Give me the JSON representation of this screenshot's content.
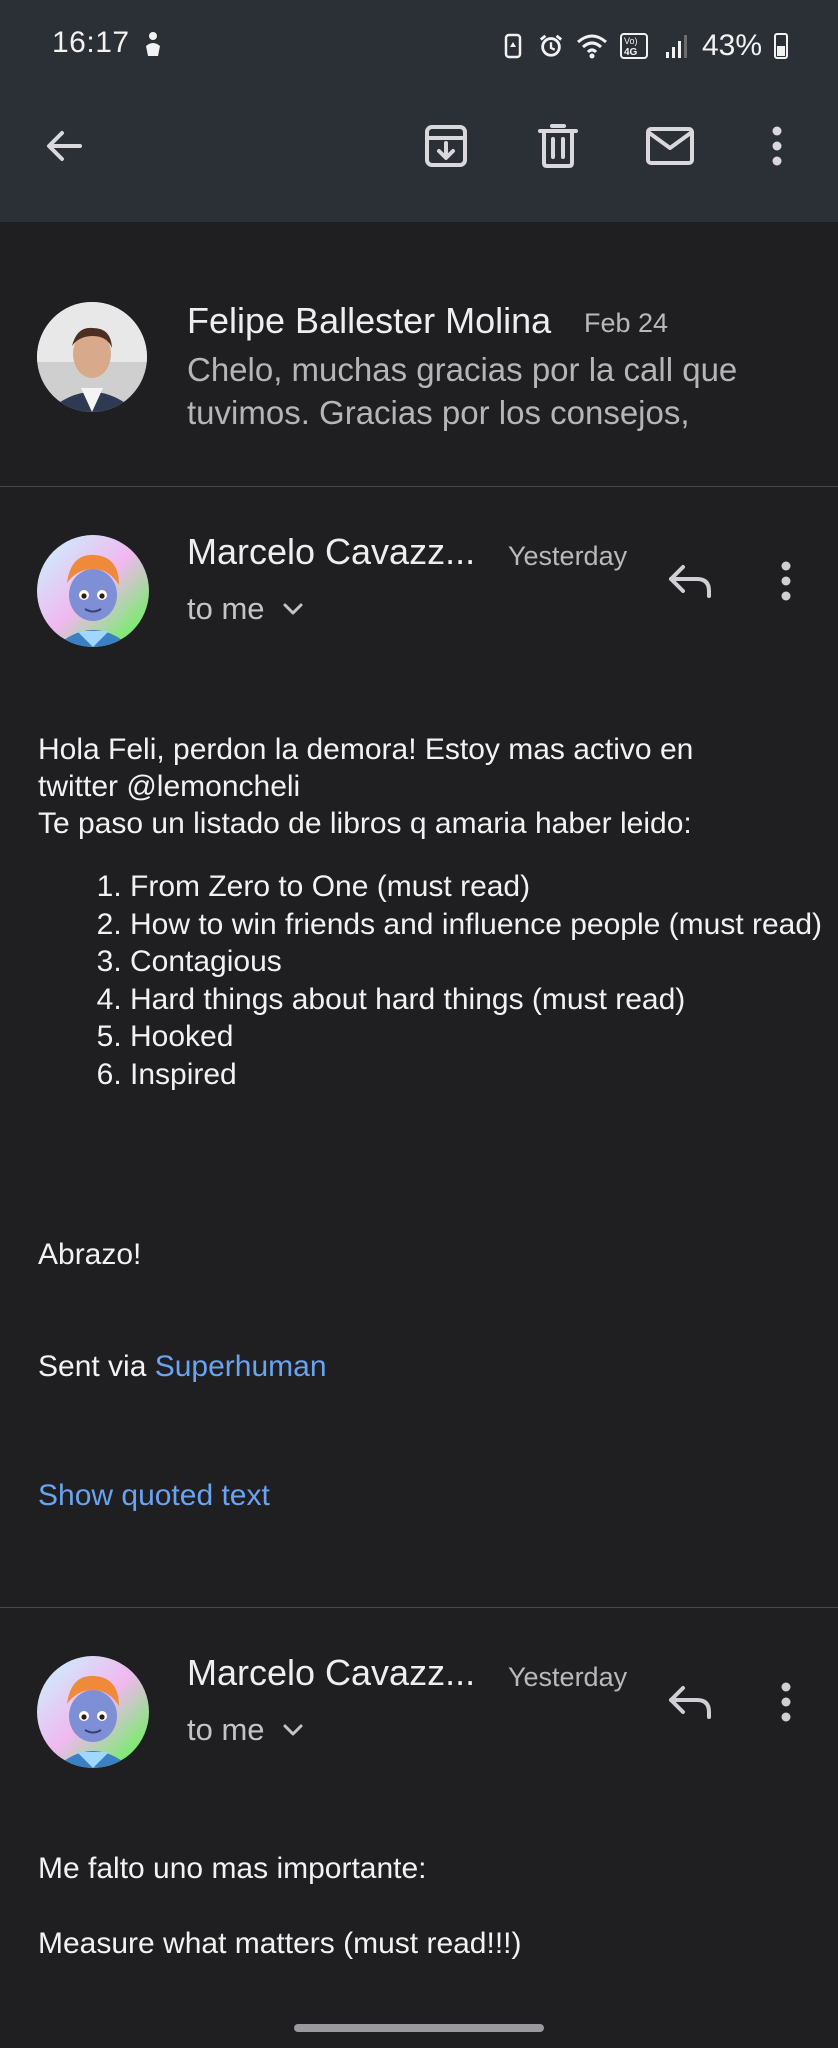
{
  "status_bar": {
    "time": "16:17",
    "battery_percent": "43%",
    "icons": [
      "accessibility-icon",
      "battery-saver-icon",
      "alarm-icon",
      "wifi-icon",
      "volte-4g-icon",
      "signal-icon",
      "battery-icon"
    ]
  },
  "toolbar": {
    "back_icon": "arrow-left-icon",
    "archive_icon": "archive-icon",
    "delete_icon": "trash-icon",
    "mark_unread_icon": "mail-icon",
    "more_icon": "more-vert-icon"
  },
  "collapsed_message": {
    "sender": "Felipe Ballester Molina",
    "date": "Feb 24",
    "snippet": "Chelo, muchas gracias por la call que tuvimos. Gracias por los consejos,"
  },
  "message1": {
    "sender": "Marcelo Cavazz...",
    "date": "Yesterday",
    "recipient": "to me",
    "greeting_line1": "Hola Feli, perdon la demora!  Estoy mas activo en",
    "greeting_line2": "twitter @lemoncheli",
    "intro": "Te paso un listado de libros q amaria haber leido:",
    "books": [
      "From Zero to One (must read)",
      "How to win friends and influence people (must read)",
      "Contagious",
      "Hard things about hard things (must read)",
      "Hooked",
      "Inspired"
    ],
    "closing": "Abrazo!",
    "sent_via_prefix": "Sent via ",
    "sent_via_link": "Superhuman",
    "show_quoted": "Show quoted text"
  },
  "message2": {
    "sender": "Marcelo Cavazz...",
    "date": "Yesterday",
    "recipient": "to me",
    "line1": "Me falto uno mas importante:",
    "line2": "Measure what matters (must read!!!)"
  },
  "colors": {
    "background": "#1f1f21",
    "toolbar": "#2b2f36",
    "link": "#6aa3f2"
  }
}
